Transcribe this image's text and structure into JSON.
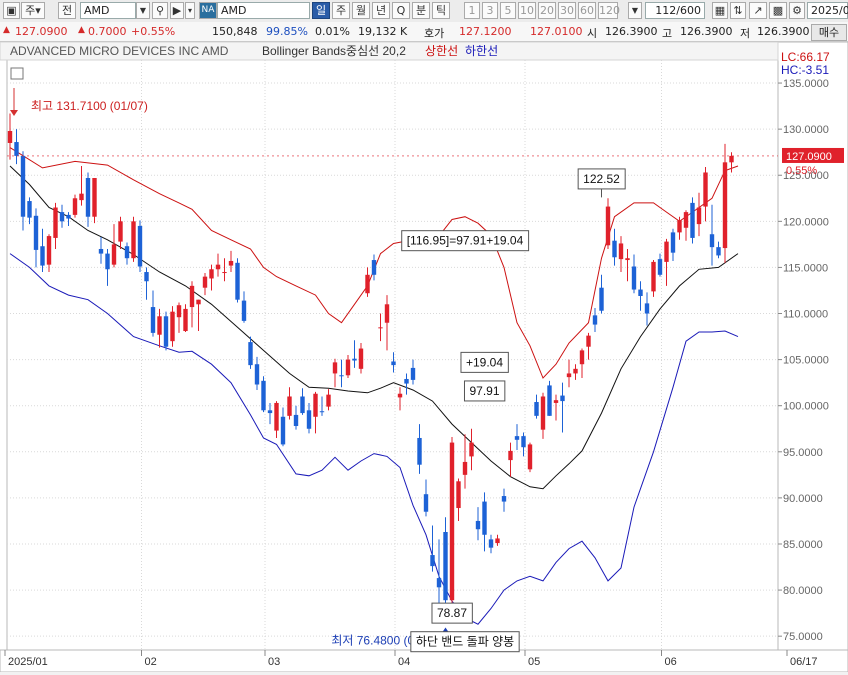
{
  "toolbar": {
    "mode_label": "주",
    "prev_label": "전",
    "symbol": "AMD",
    "na_badge": "NA",
    "symbol_name": "AMD",
    "periods": [
      "일",
      "주",
      "월",
      "년",
      "Q",
      "분",
      "틱"
    ],
    "active_period": "일",
    "intervals": [
      "1",
      "3",
      "5",
      "10",
      "20",
      "30",
      "60",
      "120"
    ],
    "count_display": "112/600",
    "date_display": "2025/0"
  },
  "quote": {
    "price": "127.0900",
    "change": "0.7000",
    "change_pct": "+0.55%",
    "volume": "150,848",
    "volume_ratio": "99.85%",
    "turnover_pct": "0.01%",
    "trade_value": "19,132 K",
    "bid_label": "호가",
    "bid": "127.1200",
    "ask": "127.0100",
    "open_label": "시",
    "open": "126.3900",
    "high_label": "고",
    "high": "126.3900",
    "low_label": "저",
    "low": "126.3900",
    "buy_label": "매수"
  },
  "colors": {
    "up": "#e0212b",
    "down": "#1d62d6",
    "upper_band": "#cc1111",
    "lower_band": "#1a1ab8",
    "middle_band": "#111111",
    "price_tag_bg": "#e0212b"
  },
  "chart_data": {
    "type": "candlestick",
    "title": "ADVANCED MICRO DEVICES INC  AMD",
    "indicator_label": "Bollinger Bands중심선 20,2",
    "legend": [
      {
        "name": "상한선",
        "color": "#cc1111"
      },
      {
        "name": "하한선",
        "color": "#1a1ab8"
      }
    ],
    "ylim": [
      73.5,
      137.5
    ],
    "y_ticks": [
      "135.0000",
      "130.0000",
      "125.0000",
      "120.0000",
      "115.0000",
      "110.0000",
      "105.0000",
      "100.0000",
      "95.0000",
      "90.0000",
      "85.0000",
      "80.0000",
      "75.0000"
    ],
    "y_tick_values": [
      135,
      130,
      125,
      120,
      115,
      110,
      105,
      100,
      95,
      90,
      85,
      80,
      75
    ],
    "x_labels": [
      {
        "label": "2025/01",
        "index": 0
      },
      {
        "label": "02",
        "index": 21
      },
      {
        "label": "03",
        "index": 40
      },
      {
        "label": "04",
        "index": 60
      },
      {
        "label": "05",
        "index": 80
      },
      {
        "label": "06",
        "index": 101
      },
      {
        "label": "06/17",
        "index": 111
      }
    ],
    "lc_label": "LC:66.17",
    "hc_label": "HC:-3.51",
    "last_price_label": "127.0900",
    "last_change_label": "0.55%",
    "last_price": 127.09,
    "candles": [
      [
        128.5,
        131.7,
        126.7,
        129.8
      ],
      [
        128.6,
        130.0,
        126.2,
        127.1
      ],
      [
        127.1,
        127.6,
        119.0,
        120.5
      ],
      [
        122.2,
        122.6,
        119.7,
        120.4
      ],
      [
        120.6,
        121.4,
        115.0,
        116.9
      ],
      [
        117.3,
        119.2,
        114.5,
        115.2
      ],
      [
        115.3,
        118.6,
        114.5,
        118.4
      ],
      [
        118.2,
        122.0,
        117.0,
        121.5
      ],
      [
        121.0,
        121.8,
        119.3,
        120.0
      ],
      [
        120.7,
        121.0,
        119.5,
        120.3
      ],
      [
        120.7,
        122.9,
        120.4,
        122.5
      ],
      [
        122.3,
        126.0,
        121.7,
        123.0
      ],
      [
        124.7,
        125.3,
        119.4,
        120.5
      ],
      [
        120.5,
        123.4,
        119.8,
        124.7
      ],
      [
        117.0,
        118.3,
        115.4,
        116.5
      ],
      [
        116.5,
        117.0,
        113.0,
        114.8
      ],
      [
        115.3,
        119.7,
        115.0,
        117.5
      ],
      [
        117.8,
        120.5,
        117.0,
        120.0
      ],
      [
        117.3,
        117.7,
        115.3,
        116.0
      ],
      [
        116.0,
        120.5,
        115.6,
        120.0
      ],
      [
        119.5,
        120.1,
        114.5,
        115.1
      ],
      [
        114.5,
        115.0,
        111.5,
        113.5
      ],
      [
        110.7,
        112.5,
        107.5,
        107.9
      ],
      [
        107.7,
        110.5,
        106.3,
        109.7
      ],
      [
        109.7,
        110.2,
        106.0,
        106.4
      ],
      [
        107.0,
        110.8,
        106.4,
        110.2
      ],
      [
        109.6,
        111.2,
        107.9,
        110.9
      ],
      [
        108.1,
        111.0,
        108.0,
        110.5
      ],
      [
        110.7,
        113.5,
        108.5,
        113.0
      ],
      [
        111.0,
        111.5,
        108.1,
        111.5
      ],
      [
        112.8,
        114.4,
        112.0,
        114.0
      ],
      [
        113.8,
        115.3,
        112.5,
        114.8
      ],
      [
        114.8,
        116.5,
        114.0,
        115.3
      ],
      [
        114.5,
        116.0,
        113.5,
        114.5
      ],
      [
        115.2,
        116.8,
        114.5,
        115.7
      ],
      [
        115.5,
        116.0,
        111.2,
        111.5
      ],
      [
        111.4,
        112.4,
        109.0,
        109.2
      ],
      [
        106.9,
        107.5,
        104.0,
        104.4
      ],
      [
        104.5,
        105.3,
        101.7,
        102.3
      ],
      [
        102.7,
        103.2,
        99.3,
        99.5
      ],
      [
        99.5,
        100.3,
        98.0,
        99.2
      ],
      [
        97.3,
        100.5,
        96.5,
        100.3
      ],
      [
        98.8,
        99.8,
        95.6,
        95.8
      ],
      [
        98.9,
        102.0,
        98.5,
        101.0
      ],
      [
        99.0,
        100.0,
        97.4,
        97.8
      ],
      [
        101.0,
        101.9,
        99.0,
        99.2
      ],
      [
        99.5,
        100.3,
        97.0,
        97.5
      ],
      [
        98.8,
        101.5,
        97.0,
        101.3
      ],
      [
        99.4,
        101.0,
        98.9,
        99.3
      ],
      [
        99.9,
        101.8,
        99.5,
        101.2
      ],
      [
        103.5,
        105.1,
        102.0,
        104.7
      ],
      [
        103.3,
        105.0,
        102.0,
        103.2
      ],
      [
        103.3,
        105.5,
        103.0,
        105.0
      ],
      [
        105.1,
        107.1,
        104.1,
        104.9
      ],
      [
        104.0,
        106.8,
        103.5,
        106.2
      ],
      [
        112.2,
        115.0,
        111.8,
        114.2
      ],
      [
        115.8,
        116.4,
        113.6,
        114.2
      ],
      [
        108.5,
        110.0,
        107.0,
        108.5
      ],
      [
        109.0,
        112.0,
        106.0,
        111.0
      ],
      [
        104.8,
        105.8,
        103.6,
        104.4
      ],
      [
        100.9,
        102.0,
        99.5,
        101.3
      ],
      [
        102.9,
        103.5,
        101.2,
        102.4
      ],
      [
        104.1,
        105.0,
        102.3,
        102.8
      ],
      [
        96.5,
        98.0,
        92.6,
        93.6
      ],
      [
        90.4,
        92.0,
        88.0,
        88.5
      ],
      [
        83.8,
        87.0,
        82.0,
        82.6
      ],
      [
        81.3,
        85.5,
        78.6,
        80.3
      ],
      [
        86.3,
        87.9,
        76.8,
        78.9
      ],
      [
        78.9,
        96.6,
        77.7,
        96.0
      ],
      [
        88.9,
        92.1,
        87.5,
        91.8
      ],
      [
        92.5,
        96.9,
        91.0,
        93.9
      ],
      [
        94.5,
        97.5,
        93.0,
        96.0
      ],
      [
        87.5,
        89.0,
        85.4,
        86.6
      ],
      [
        89.6,
        90.6,
        84.2,
        86.0
      ],
      [
        85.5,
        86.0,
        84.0,
        84.6
      ],
      [
        85.1,
        86.0,
        84.8,
        85.6
      ],
      [
        90.2,
        91.0,
        88.5,
        89.6
      ],
      [
        94.1,
        96.0,
        92.3,
        95.1
      ],
      [
        96.7,
        98.0,
        95.2,
        96.3
      ],
      [
        96.7,
        97.1,
        94.5,
        95.5
      ],
      [
        93.1,
        96.0,
        92.8,
        95.8
      ],
      [
        100.4,
        101.2,
        98.6,
        98.9
      ],
      [
        97.4,
        101.4,
        96.4,
        101.0
      ],
      [
        102.2,
        102.7,
        98.9,
        98.9
      ],
      [
        100.3,
        101.2,
        98.4,
        100.6
      ],
      [
        101.1,
        102.5,
        97.1,
        100.5
      ],
      [
        103.1,
        105.0,
        102.0,
        103.5
      ],
      [
        103.5,
        104.5,
        102.8,
        104.0
      ],
      [
        104.5,
        106.2,
        103.0,
        106.0
      ],
      [
        106.4,
        107.9,
        105.0,
        107.6
      ],
      [
        109.8,
        110.6,
        108.0,
        108.8
      ],
      [
        112.8,
        114.2,
        110.0,
        110.3
      ],
      [
        117.4,
        122.5,
        117.0,
        121.6
      ],
      [
        117.9,
        119.2,
        115.2,
        116.1
      ],
      [
        115.9,
        118.4,
        114.5,
        117.6
      ],
      [
        115.8,
        117.0,
        113.5,
        116.0
      ],
      [
        115.1,
        116.4,
        112.2,
        112.6
      ],
      [
        112.6,
        113.5,
        110.3,
        111.9
      ],
      [
        111.1,
        112.3,
        108.7,
        110.0
      ],
      [
        112.4,
        115.8,
        111.8,
        115.6
      ],
      [
        115.9,
        116.5,
        114.0,
        114.2
      ],
      [
        115.6,
        118.1,
        113.0,
        117.8
      ],
      [
        118.8,
        119.2,
        115.7,
        116.6
      ],
      [
        118.8,
        120.5,
        118.0,
        120.1
      ],
      [
        119.3,
        121.2,
        117.9,
        121.0
      ],
      [
        122.0,
        122.6,
        117.6,
        118.2
      ],
      [
        119.7,
        123.1,
        118.4,
        121.5
      ],
      [
        121.6,
        125.9,
        120.0,
        125.3
      ],
      [
        118.6,
        121.8,
        115.2,
        117.2
      ],
      [
        117.2,
        117.8,
        116.0,
        116.3
      ],
      [
        117.1,
        128.4,
        115.5,
        126.4
      ],
      [
        126.4,
        127.5,
        125.3,
        127.1
      ]
    ],
    "upper_band": [
      [
        0,
        128.0
      ],
      [
        5,
        125.8
      ],
      [
        10,
        126.5
      ],
      [
        15,
        126.1
      ],
      [
        19,
        124.5
      ],
      [
        23,
        123.0
      ],
      [
        26,
        122.0
      ],
      [
        28,
        121.3
      ],
      [
        31,
        119.0
      ],
      [
        34,
        118.0
      ],
      [
        37,
        117.0
      ],
      [
        39,
        115.0
      ],
      [
        41,
        114.0
      ],
      [
        44,
        113.0
      ],
      [
        47,
        112.0
      ],
      [
        49,
        110.0
      ],
      [
        51,
        109.0
      ],
      [
        53,
        111.0
      ],
      [
        55,
        113.0
      ],
      [
        57,
        116.5
      ],
      [
        59,
        117.6
      ],
      [
        62,
        118.0
      ],
      [
        64,
        117.6
      ],
      [
        66,
        118.4
      ],
      [
        68,
        120.2
      ],
      [
        70,
        120.5
      ],
      [
        72,
        119.8
      ],
      [
        74,
        118.5
      ],
      [
        76,
        115.0
      ],
      [
        78,
        109.0
      ],
      [
        80,
        106.5
      ],
      [
        82,
        103.0
      ],
      [
        84,
        104.5
      ],
      [
        86,
        106.8
      ],
      [
        89,
        109.0
      ],
      [
        91,
        116.0
      ],
      [
        93,
        120.5
      ],
      [
        96,
        122.0
      ],
      [
        99,
        122.0
      ],
      [
        101,
        121.0
      ],
      [
        103,
        120.0
      ],
      [
        105,
        121.0
      ],
      [
        108,
        122.5
      ],
      [
        110,
        125.5
      ],
      [
        112,
        126.0
      ]
    ],
    "middle_band": [
      [
        0,
        126.0
      ],
      [
        3,
        124.0
      ],
      [
        6,
        121.5
      ],
      [
        9,
        120.5
      ],
      [
        12,
        119.0
      ],
      [
        15,
        118.0
      ],
      [
        19,
        116.4
      ],
      [
        23,
        114.5
      ],
      [
        27,
        113.0
      ],
      [
        31,
        111.0
      ],
      [
        35,
        108.5
      ],
      [
        39,
        106.0
      ],
      [
        43,
        103.5
      ],
      [
        46,
        102.0
      ],
      [
        49,
        101.9
      ],
      [
        52,
        101.6
      ],
      [
        55,
        101.4
      ],
      [
        57,
        101.9
      ],
      [
        59,
        102.5
      ],
      [
        62,
        101.7
      ],
      [
        65,
        100.5
      ],
      [
        68,
        98.0
      ],
      [
        71,
        96.0
      ],
      [
        74,
        94.0
      ],
      [
        77,
        92.3
      ],
      [
        80,
        91.2
      ],
      [
        82,
        91.0
      ],
      [
        84,
        92.4
      ],
      [
        86,
        93.7
      ],
      [
        88,
        95.1
      ],
      [
        91,
        99.2
      ],
      [
        94,
        104.0
      ],
      [
        97,
        107.5
      ],
      [
        100,
        110.5
      ],
      [
        103,
        113.0
      ],
      [
        106,
        114.8
      ],
      [
        109,
        115.0
      ],
      [
        112,
        116.5
      ]
    ],
    "lower_band": [
      [
        0,
        116.5
      ],
      [
        3,
        115.0
      ],
      [
        6,
        113.0
      ],
      [
        9,
        112.0
      ],
      [
        12,
        111.5
      ],
      [
        15,
        110.0
      ],
      [
        19,
        107.5
      ],
      [
        23,
        106.5
      ],
      [
        26,
        105.8
      ],
      [
        28,
        105.9
      ],
      [
        31,
        104.5
      ],
      [
        34,
        102.5
      ],
      [
        37,
        99.0
      ],
      [
        39,
        96.5
      ],
      [
        41,
        95.8
      ],
      [
        44,
        92.6
      ],
      [
        46,
        92.4
      ],
      [
        48,
        93.0
      ],
      [
        50,
        94.4
      ],
      [
        52,
        93.0
      ],
      [
        54,
        94.0
      ],
      [
        56,
        94.8
      ],
      [
        58,
        94.5
      ],
      [
        60,
        93.3
      ],
      [
        62,
        89.2
      ],
      [
        64,
        86.0
      ],
      [
        66,
        81.5
      ],
      [
        68,
        78.8
      ],
      [
        70,
        77.0
      ],
      [
        72,
        76.3
      ],
      [
        74,
        78.0
      ],
      [
        76,
        80.0
      ],
      [
        78,
        81.0
      ],
      [
        80,
        81.5
      ],
      [
        82,
        81.0
      ],
      [
        84,
        83.0
      ],
      [
        86,
        84.5
      ],
      [
        88,
        85.3
      ],
      [
        90,
        83.5
      ],
      [
        92,
        81.0
      ],
      [
        94,
        82.4
      ],
      [
        96,
        89.0
      ],
      [
        99,
        95.0
      ],
      [
        102,
        102.0
      ],
      [
        104,
        107.0
      ],
      [
        106,
        108.0
      ],
      [
        108,
        108.0
      ],
      [
        110,
        108.1
      ],
      [
        112,
        107.5
      ]
    ],
    "annotations": [
      {
        "text": "최고 131.7100 (01/07)",
        "index": 1,
        "value": 131.71,
        "kind": "high_marker"
      },
      {
        "text": "최저 76.4800 (04/08)",
        "index": 67,
        "value": 76.48,
        "kind": "low_marker"
      },
      {
        "text": "[116.95]=97.91+19.04",
        "index": 70,
        "value": 117.9,
        "kind": "box"
      },
      {
        "text": "+19.04",
        "index": 73,
        "value": 104.7,
        "kind": "box"
      },
      {
        "text": "97.91",
        "index": 73,
        "value": 101.6,
        "kind": "box"
      },
      {
        "text": "122.52",
        "index": 91,
        "value": 124.6,
        "kind": "box"
      },
      {
        "text": "78.87",
        "index": 68,
        "value": 77.5,
        "kind": "box"
      },
      {
        "text": "하단 밴드 돌파 양봉",
        "index": 70,
        "value": 74.4,
        "kind": "box"
      }
    ]
  }
}
